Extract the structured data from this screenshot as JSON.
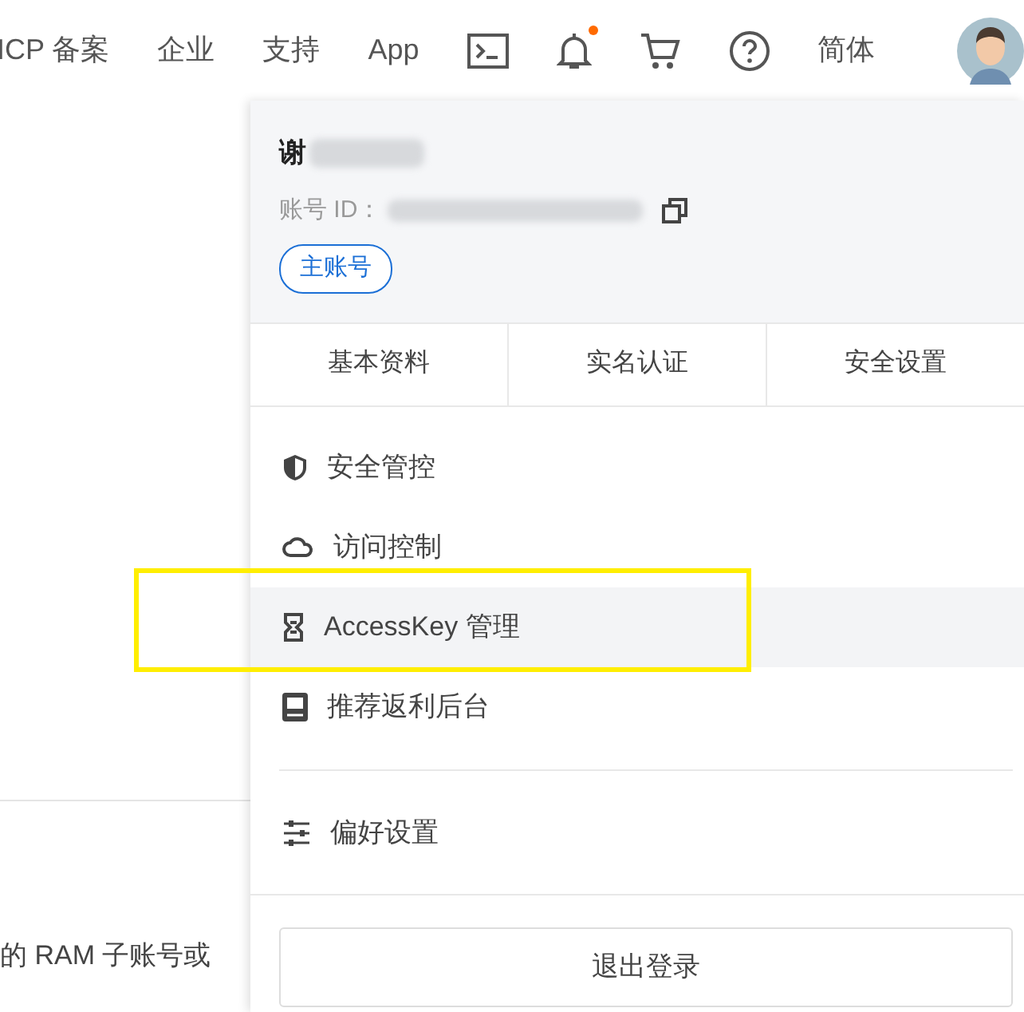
{
  "top_nav": {
    "items": [
      {
        "kind": "text",
        "label": "ICP 备案"
      },
      {
        "kind": "text",
        "label": "企业"
      },
      {
        "kind": "text",
        "label": "支持"
      },
      {
        "kind": "text",
        "label": "App"
      },
      {
        "kind": "terminal"
      },
      {
        "kind": "bell",
        "unread": true
      },
      {
        "kind": "cart"
      },
      {
        "kind": "help"
      },
      {
        "kind": "text",
        "label": "简体"
      },
      {
        "kind": "avatar"
      }
    ]
  },
  "background_text": "的 RAM 子账号或",
  "account_menu": {
    "name": "谢",
    "id_label": "账号 ID：",
    "badge": "主账号",
    "tabs": [
      "基本资料",
      "实名认证",
      "安全设置"
    ],
    "items": [
      {
        "label": "安全管控",
        "selected": false
      },
      {
        "label": "访问控制",
        "selected": false
      },
      {
        "label": "AccessKey 管理",
        "selected": true
      },
      {
        "label": "推荐返利后台",
        "selected": false
      }
    ],
    "settings_item": {
      "label": "偏好设置"
    },
    "logout_button": "退出登录"
  }
}
